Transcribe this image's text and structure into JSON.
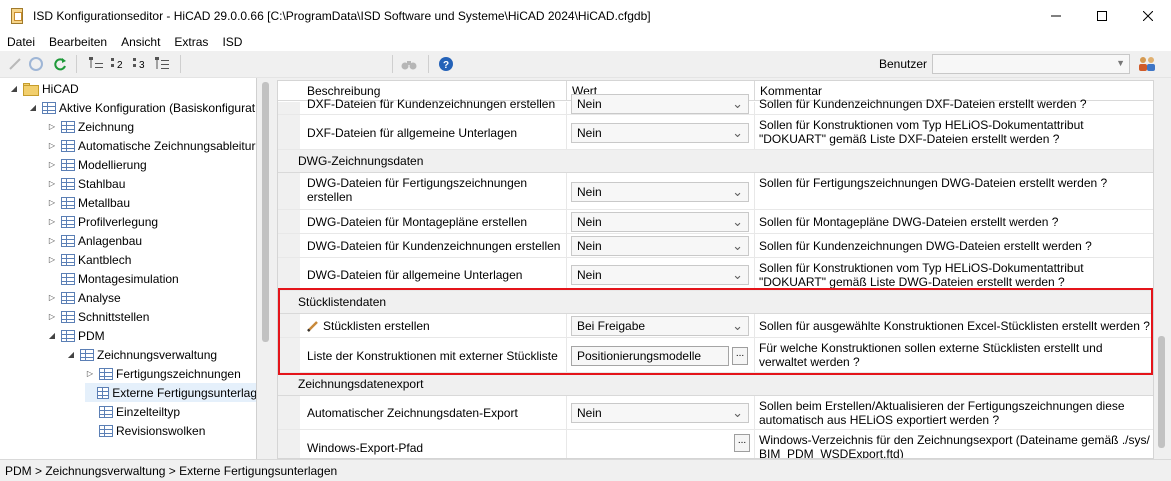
{
  "window": {
    "title": "ISD Konfigurationseditor  -  HiCAD 29.0.0.66 [C:\\ProgramData\\ISD Software und Systeme\\HiCAD 2024\\HiCAD.cfgdb]",
    "minimize": "—",
    "maximize": "☐",
    "close": "✕"
  },
  "menu": [
    "Datei",
    "Bearbeiten",
    "Ansicht",
    "Extras",
    "ISD"
  ],
  "toolbar": {
    "user_label": "Benutzer",
    "user_value": "",
    "icons": [
      "pencil-icon",
      "undo-icon",
      "refresh-icon",
      "level-1-icon",
      "level-2-icon",
      "level-3-icon",
      "level-all-icon",
      "binoculars-icon",
      "help-icon",
      "users-icon"
    ],
    "level_labels": [
      "1",
      "2",
      "3",
      ""
    ]
  },
  "tree": [
    {
      "label": "HiCAD",
      "level": 0,
      "expander": "expanded",
      "icon": "folder"
    },
    {
      "label": "Aktive Konfiguration (Basiskonfigurat",
      "level": 1,
      "expander": "expanded",
      "icon": "table"
    },
    {
      "label": "Zeichnung",
      "level": 2,
      "expander": "collapsed",
      "icon": "table"
    },
    {
      "label": "Automatische Zeichnungsableitur",
      "level": 2,
      "expander": "collapsed",
      "icon": "table"
    },
    {
      "label": "Modellierung",
      "level": 2,
      "expander": "collapsed",
      "icon": "table"
    },
    {
      "label": "Stahlbau",
      "level": 2,
      "expander": "collapsed",
      "icon": "table"
    },
    {
      "label": "Metallbau",
      "level": 2,
      "expander": "collapsed",
      "icon": "table"
    },
    {
      "label": "Profilverlegung",
      "level": 2,
      "expander": "collapsed",
      "icon": "table"
    },
    {
      "label": "Anlagenbau",
      "level": 2,
      "expander": "collapsed",
      "icon": "table"
    },
    {
      "label": "Kantblech",
      "level": 2,
      "expander": "collapsed",
      "icon": "table"
    },
    {
      "label": "Montagesimulation",
      "level": 2,
      "expander": "none",
      "icon": "table"
    },
    {
      "label": "Analyse",
      "level": 2,
      "expander": "collapsed",
      "icon": "table"
    },
    {
      "label": "Schnittstellen",
      "level": 2,
      "expander": "collapsed",
      "icon": "table"
    },
    {
      "label": "PDM",
      "level": 2,
      "expander": "expanded",
      "icon": "table"
    },
    {
      "label": "Zeichnungsverwaltung",
      "level": 3,
      "expander": "expanded",
      "icon": "table"
    },
    {
      "label": "Fertigungszeichnungen",
      "level": 4,
      "expander": "collapsed",
      "icon": "table"
    },
    {
      "label": "Externe Fertigungsunterlag",
      "level": 4,
      "expander": "none",
      "icon": "table",
      "selected": true
    },
    {
      "label": "Einzelteiltyp",
      "level": 4,
      "expander": "none",
      "icon": "table"
    },
    {
      "label": "Revisionswolken",
      "level": 4,
      "expander": "none",
      "icon": "table"
    }
  ],
  "grid": {
    "headers": {
      "desc": "Beschreibung",
      "value": "Wert",
      "comment": "Kommentar"
    },
    "rows": [
      {
        "kind": "row",
        "desc": "DXF-Dateien für Kundenzeichnungen erstellen",
        "value": "Nein",
        "comment": "Sollen für Kundenzeichnungen DXF-Dateien erstellt werden ?",
        "partial": true
      },
      {
        "kind": "row",
        "desc": "DXF-Dateien für allgemeine Unterlagen",
        "value": "Nein",
        "comment": "Sollen für Konstruktionen vom Typ HELiOS-Dokumentattribut \"DOKUART\" gemäß Liste DXF-Dateien erstellt werden ?"
      },
      {
        "kind": "cat",
        "label": "DWG-Zeichnungsdaten"
      },
      {
        "kind": "row",
        "desc": "DWG-Dateien für Fertigungszeichnungen erstellen",
        "value": "Nein",
        "comment": "Sollen für Fertigungszeichnungen DWG-Dateien erstellt werden ?"
      },
      {
        "kind": "row",
        "desc": "DWG-Dateien für Montagepläne erstellen",
        "value": "Nein",
        "comment": "Sollen für Montagepläne DWG-Dateien erstellt werden ?"
      },
      {
        "kind": "row",
        "desc": "DWG-Dateien für Kundenzeichnungen erstellen",
        "value": "Nein",
        "comment": "Sollen für Kundenzeichnungen DWG-Dateien erstellt werden ?"
      },
      {
        "kind": "row",
        "desc": "DWG-Dateien für allgemeine Unterlagen",
        "value": "Nein",
        "comment": "Sollen für Konstruktionen vom Typ HELiOS-Dokumentattribut \"DOKUART\" gemäß Liste DWG-Dateien erstellt werden ?"
      },
      {
        "kind": "cat",
        "label": "Stücklistendaten"
      },
      {
        "kind": "row",
        "desc": "Stücklisten erstellen",
        "value": "Bei Freigabe",
        "comment": "Sollen für ausgewählte Konstruktionen Excel-Stücklisten erstellt werden ?",
        "edited": true
      },
      {
        "kind": "row",
        "desc": "Liste der Konstruktionen mit externer Stückliste",
        "value": "Positionierungsmodelle",
        "button": "...",
        "comment": "Für welche Konstruktionen sollen externe Stücklisten erstellt und verwaltet werden ?"
      },
      {
        "kind": "cat",
        "label": "Zeichnungsdatenexport"
      },
      {
        "kind": "row",
        "desc": "Automatischer Zeichnungsdaten-Export",
        "value": "Nein",
        "comment": "Sollen beim Erstellen/Aktualisieren der Fertigungszeichnungen diese automatisch aus HELiOS exportiert werden ?"
      },
      {
        "kind": "row",
        "desc": "Windows-Export-Pfad",
        "value": "",
        "button": "...",
        "comment": "Windows-Verzeichnis für den Zeichnungsexport (Dateiname gemäß ./sys/ BIM_PDM_WSDExport.ftd)"
      }
    ]
  },
  "status": "PDM > Zeichnungsverwaltung > Externe Fertigungsunterlagen",
  "colors": {
    "highlight": "#e4141a",
    "selected": "#e5f0fb",
    "category_bg": "#f0f0f0"
  }
}
